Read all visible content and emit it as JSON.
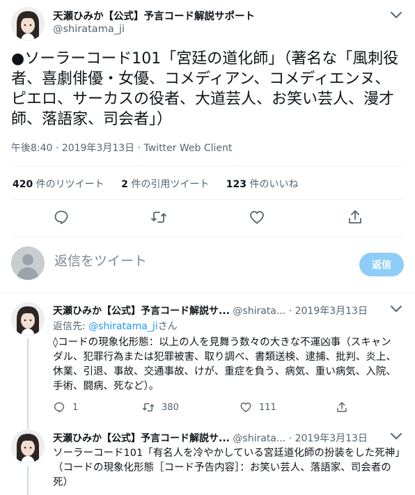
{
  "main_tweet": {
    "author_name": "天瀬ひみか【公式】予言コード解説サポート",
    "handle": "@shiratama_ji",
    "text": "●ソーラーコード101「宮廷の道化師」（著名な「風刺役者、喜劇俳優・女優、コメディアン、コメディエンヌ、ピエロ、サーカスの役者、大道芸人、お笑い芸人、漫才師、落語家、司会者」）",
    "meta": "午後8:40 · 2019年3月13日 · Twitter Web Client",
    "stats": [
      {
        "count": "420",
        "label": " 件のリツイート"
      },
      {
        "count": "2",
        "label": " 件の引用ツイート"
      },
      {
        "count": "123",
        "label": " 件のいいね"
      }
    ],
    "actions": [
      "reply-icon",
      "retweet-icon",
      "like-icon",
      "share-icon"
    ]
  },
  "composer": {
    "placeholder": "返信をツイート",
    "button_label": "返信"
  },
  "replies": [
    {
      "author_name": "天瀬ひみか【公式】予言コード解説サ...",
      "handle": "@shirata...",
      "dot": "·",
      "date": "2019年3月13日",
      "reply_to_prefix": "返信先: ",
      "reply_to_handle": "@shiratama_ji",
      "reply_to_suffix": "さん",
      "text": "◊コードの現象化形態：以上の人を見舞う数々の大きな不運凶事（スキャンダル、犯罪行為または犯罪被害、取り調べ、書類送検、逮捕、批判、炎上、休業、引退、事故、交通事故、けが、重症を負う、病気、重い病気、入院、手術、闘病、死など）。",
      "reply_count": "1",
      "retweet_count": "380",
      "like_count": "111"
    },
    {
      "author_name": "天瀬ひみか【公式】予言コード解説サ...",
      "handle": "@shirata...",
      "dot": "·",
      "date": "2019年3月13日",
      "text": "ソーラーコード101「有名人を冷やかしている宮廷道化師の扮装をした死神」（コードの現象化形態［コード予告内容］：お笑い芸人、落語家、司会者の死）"
    }
  ],
  "colors": {
    "link": "#1d9bf0",
    "reply_button": "#8ecdf7",
    "muted_text": "#536471"
  }
}
